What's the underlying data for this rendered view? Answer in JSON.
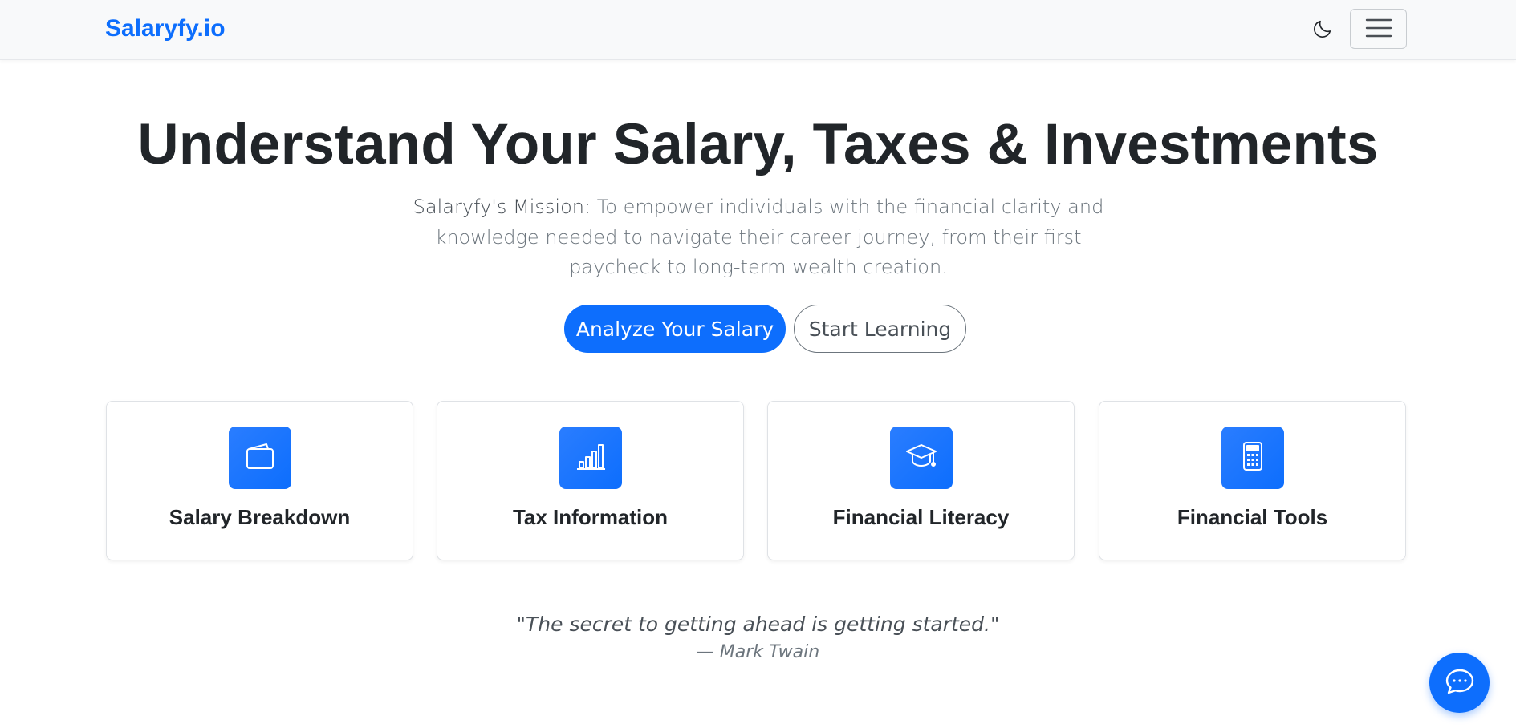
{
  "navbar": {
    "brand": "Salaryfy.io",
    "theme_toggle_icon": "moon-icon",
    "menu_icon": "hamburger-menu-icon"
  },
  "hero": {
    "title": "Understand Your Salary, Taxes & Investments",
    "mission_label": "Salaryfy's Mission:",
    "mission_text": " To empower individuals with the financial clarity and knowledge needed to navigate their career journey, from their first paycheck to long-term wealth creation.",
    "primary_button": "Analyze Your Salary",
    "secondary_button": "Start Learning"
  },
  "cards": [
    {
      "title": "Salary Breakdown",
      "icon": "wallet-icon"
    },
    {
      "title": "Tax Information",
      "icon": "bar-chart-icon"
    },
    {
      "title": "Financial Literacy",
      "icon": "graduation-cap-icon"
    },
    {
      "title": "Financial Tools",
      "icon": "calculator-icon"
    }
  ],
  "quote": {
    "text": "\"The secret to getting ahead is getting started.\"",
    "author": "— Mark Twain"
  },
  "chat": {
    "icon": "chat-bubble-icon"
  },
  "colors": {
    "accent": "#0d6efd",
    "text": "#212529",
    "muted": "#6c757d",
    "navbar_bg": "#f8f9fa"
  }
}
